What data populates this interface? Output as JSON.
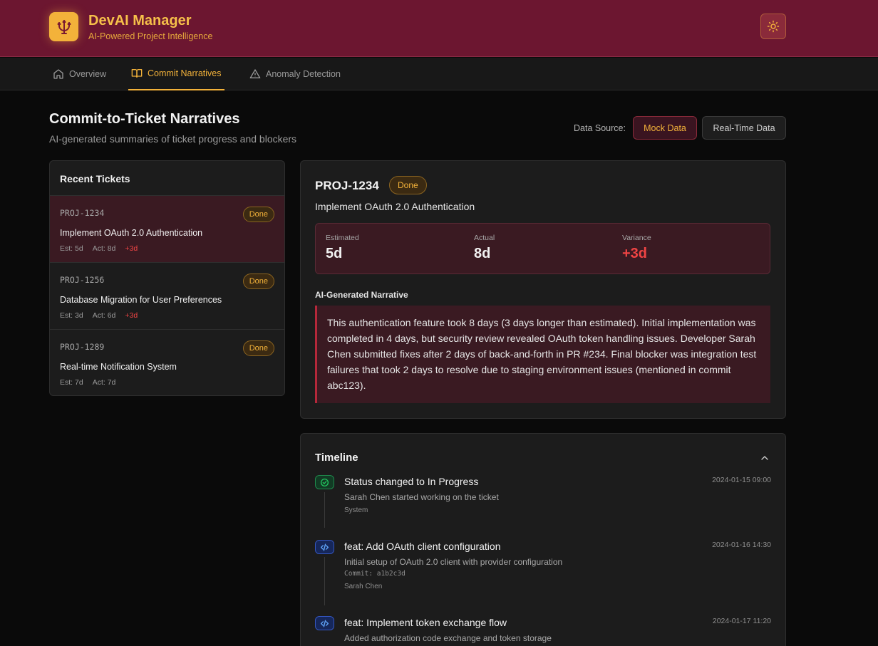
{
  "header": {
    "app_title": "DevAI Manager",
    "app_subtitle": "AI-Powered Project Intelligence",
    "logo_icon": "trident-icon",
    "theme_icon": "sun-icon"
  },
  "nav": {
    "tabs": [
      {
        "label": "Overview",
        "icon": "home-icon"
      },
      {
        "label": "Commit Narratives",
        "icon": "book-icon",
        "active": true
      },
      {
        "label": "Anomaly Detection",
        "icon": "warning-triangle-icon"
      }
    ]
  },
  "page": {
    "title": "Commit-to-Ticket Narratives",
    "subtitle": "AI-generated summaries of ticket progress and blockers",
    "data_source_label": "Data Source:",
    "mock_label": "Mock Data",
    "real_label": "Real-Time Data"
  },
  "tickets": {
    "heading": "Recent Tickets",
    "items": [
      {
        "id": "PROJ-1234",
        "status": "Done",
        "title": "Implement OAuth 2.0 Authentication",
        "est": "Est: 5d",
        "act": "Act: 8d",
        "variance": "+3d"
      },
      {
        "id": "PROJ-1256",
        "status": "Done",
        "title": "Database Migration for User Preferences",
        "est": "Est: 3d",
        "act": "Act: 6d",
        "variance": "+3d"
      },
      {
        "id": "PROJ-1289",
        "status": "Done",
        "title": "Real-time Notification System",
        "est": "Est: 7d",
        "act": "Act: 7d",
        "variance": ""
      }
    ]
  },
  "detail": {
    "id": "PROJ-1234",
    "status": "Done",
    "title": "Implement OAuth 2.0 Authentication",
    "estimated_label": "Estimated",
    "estimated": "5d",
    "actual_label": "Actual",
    "actual": "8d",
    "variance_label": "Variance",
    "variance": "+3d",
    "narrative_heading": "AI-Generated Narrative",
    "narrative": "This authentication feature took 8 days (3 days longer than estimated). Initial implementation was completed in 4 days, but security review revealed OAuth token handling issues. Developer Sarah Chen submitted fixes after 2 days of back-and-forth in PR #234. Final blocker was integration test failures that took 2 days to resolve due to staging environment issues (mentioned in commit abc123)."
  },
  "timeline": {
    "heading": "Timeline",
    "events": [
      {
        "icon": "check-circle-icon",
        "color": "#22c55e",
        "title": "Status changed to In Progress",
        "date": "2024-01-15 09:00",
        "desc": "Sarah Chen started working on the ticket",
        "commit": "",
        "author": "System"
      },
      {
        "icon": "code-icon",
        "color": "#60a5fa",
        "title": "feat: Add OAuth client configuration",
        "date": "2024-01-16 14:30",
        "desc": "Initial setup of OAuth 2.0 client with provider configuration",
        "commit": "Commit: a1b2c3d",
        "author": "Sarah Chen"
      },
      {
        "icon": "code-icon",
        "color": "#60a5fa",
        "title": "feat: Implement token exchange flow",
        "date": "2024-01-17 11:20",
        "desc": "Added authorization code exchange and token storage",
        "commit": "",
        "author": ""
      }
    ]
  }
}
